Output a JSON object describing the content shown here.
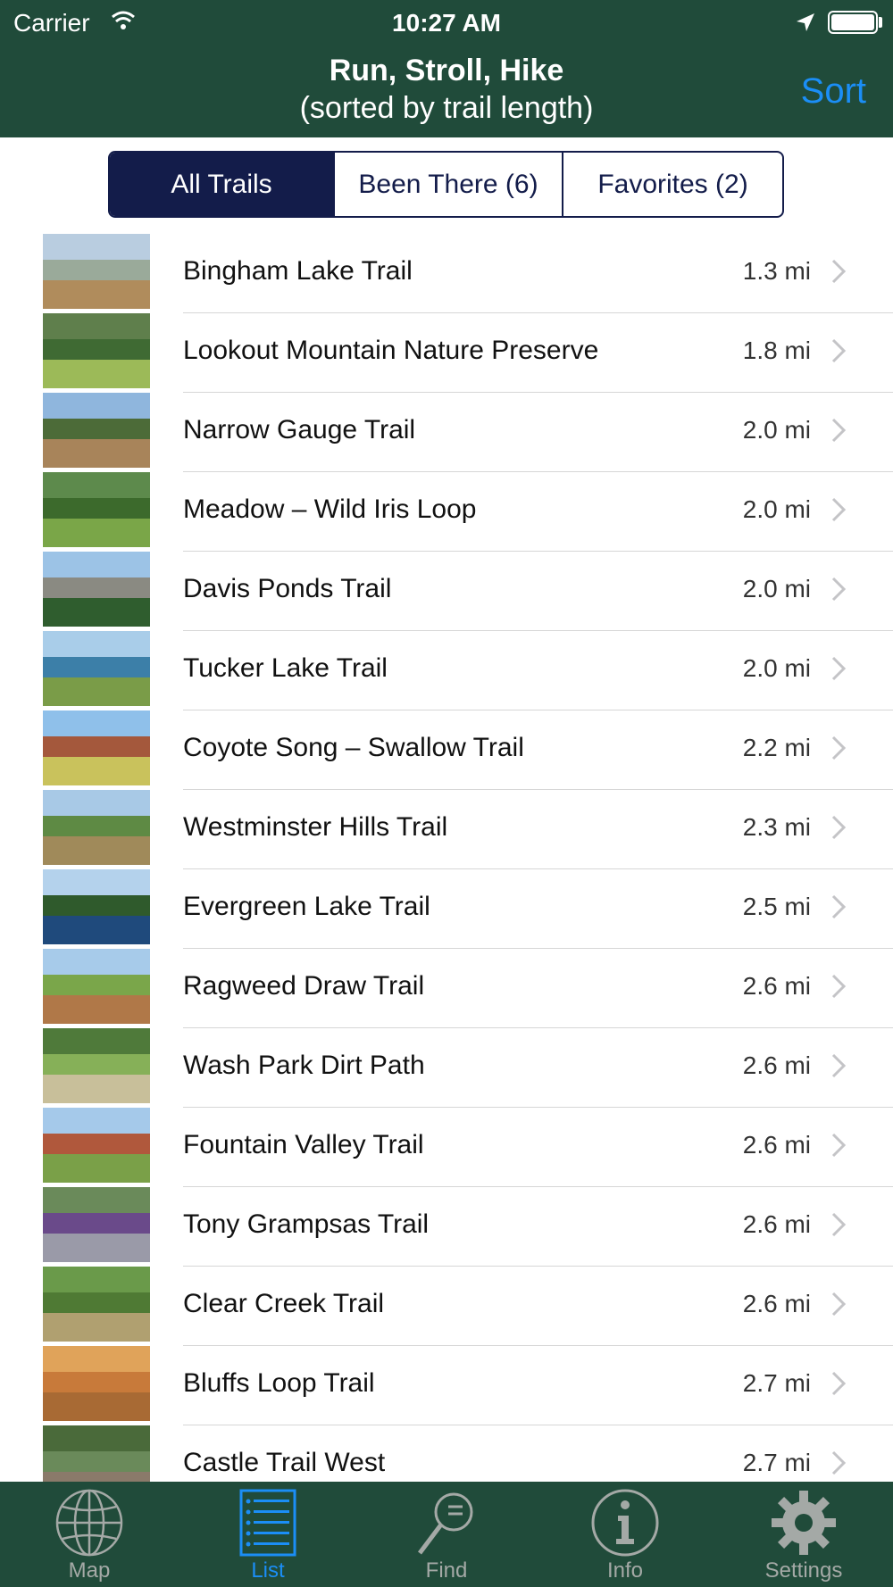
{
  "status_bar": {
    "carrier": "Carrier",
    "time": "10:27 AM"
  },
  "nav": {
    "title": "Run, Stroll, Hike",
    "subtitle": "(sorted by trail length)",
    "sort_label": "Sort"
  },
  "segments": [
    {
      "label": "All Trails",
      "selected": true
    },
    {
      "label": "Been There (6)",
      "selected": false
    },
    {
      "label": "Favorites (2)",
      "selected": false
    }
  ],
  "trails": [
    {
      "name": "Bingham Lake Trail",
      "distance": "1.3 mi",
      "colors": [
        "#b9cde0",
        "#9aaa9a",
        "#b08c5c"
      ]
    },
    {
      "name": "Lookout Mountain Nature Preserve",
      "distance": "1.8 mi",
      "colors": [
        "#5f7f4c",
        "#3f6a33",
        "#9cba58"
      ]
    },
    {
      "name": "Narrow Gauge Trail",
      "distance": "2.0 mi",
      "colors": [
        "#8fb6dd",
        "#4c6b38",
        "#a8845a"
      ]
    },
    {
      "name": "Meadow – Wild Iris Loop",
      "distance": "2.0 mi",
      "colors": [
        "#5d8a4c",
        "#3c6a2c",
        "#7aa648"
      ]
    },
    {
      "name": "Davis Ponds Trail",
      "distance": "2.0 mi",
      "colors": [
        "#9cc3e6",
        "#8a8a82",
        "#2f5d2e"
      ]
    },
    {
      "name": "Tucker Lake Trail",
      "distance": "2.0 mi",
      "colors": [
        "#a9cde9",
        "#3c7fa8",
        "#7a9c48"
      ]
    },
    {
      "name": "Coyote Song – Swallow Trail",
      "distance": "2.2 mi",
      "colors": [
        "#8fc0ea",
        "#a4583c",
        "#c9c25c"
      ]
    },
    {
      "name": "Westminster Hills Trail",
      "distance": "2.3 mi",
      "colors": [
        "#a8c9e6",
        "#5e8a44",
        "#a08a5a"
      ]
    },
    {
      "name": "Evergreen Lake Trail",
      "distance": "2.5 mi",
      "colors": [
        "#b4d2ec",
        "#2f5a2c",
        "#1f4a7c"
      ]
    },
    {
      "name": "Ragweed Draw Trail",
      "distance": "2.6 mi",
      "colors": [
        "#a7cbea",
        "#7aa64a",
        "#b07848"
      ]
    },
    {
      "name": "Wash Park Dirt Path",
      "distance": "2.6 mi",
      "colors": [
        "#4f7a3a",
        "#86b058",
        "#c8bf9a"
      ]
    },
    {
      "name": "Fountain Valley Trail",
      "distance": "2.6 mi",
      "colors": [
        "#a5c9ea",
        "#b0583c",
        "#7aa048"
      ]
    },
    {
      "name": "Tony Grampsas Trail",
      "distance": "2.6 mi",
      "colors": [
        "#6a8a5a",
        "#6a4a8a",
        "#9a9aa8"
      ]
    },
    {
      "name": "Clear Creek Trail",
      "distance": "2.6 mi",
      "colors": [
        "#6a9a4a",
        "#4f7a34",
        "#b0a070"
      ]
    },
    {
      "name": "Bluffs Loop Trail",
      "distance": "2.7 mi",
      "colors": [
        "#e0a35a",
        "#c87a3a",
        "#a86a34"
      ]
    },
    {
      "name": "Castle Trail West",
      "distance": "2.7 mi",
      "colors": [
        "#4a6a3a",
        "#6a8a5a",
        "#8a7a6a"
      ]
    }
  ],
  "tabs": [
    {
      "label": "Map",
      "icon": "globe-icon",
      "active": false
    },
    {
      "label": "List",
      "icon": "list-icon",
      "active": true
    },
    {
      "label": "Find",
      "icon": "magnifier-icon",
      "active": false
    },
    {
      "label": "Info",
      "icon": "info-icon",
      "active": false
    },
    {
      "label": "Settings",
      "icon": "gear-icon",
      "active": false
    }
  ],
  "colors": {
    "header_bg": "#204b3a",
    "segment_active": "#131c4a",
    "accent_blue": "#1b8ef6",
    "tab_inactive": "#a4a9a6"
  }
}
